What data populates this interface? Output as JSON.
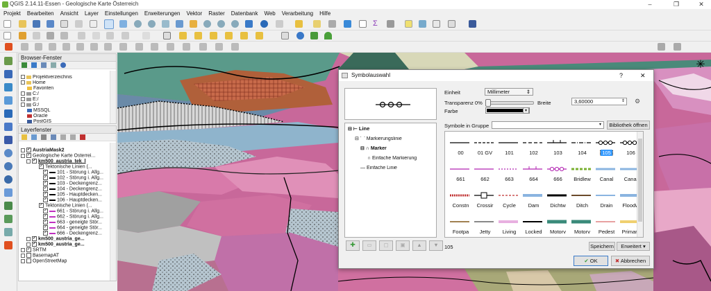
{
  "window": {
    "title": "QGIS 2.14.11-Essen - Geologische Karte Österreich"
  },
  "menu": [
    "Projekt",
    "Bearbeiten",
    "Ansicht",
    "Layer",
    "Einstellungen",
    "Erweiterungen",
    "Vektor",
    "Raster",
    "Datenbank",
    "Web",
    "Verarbeitung",
    "Hilfe"
  ],
  "browser": {
    "title": "Browser-Fenster",
    "items": [
      "Projektverzeichnis",
      "Home",
      "Favoriten",
      "C:/",
      "E:/",
      "G:/",
      "MSSQL",
      "Oracle",
      "PostGIS"
    ]
  },
  "layers": {
    "title": "Layerfenster",
    "items": [
      "AustriaMask2",
      "Geologische Karte Österrei...",
      "km500_austria_tek_l",
      "Tektonische Linien (...",
      "101 - Störung i. Allg...",
      "102 - Störung i. Allg...",
      "103 - Deckengrenz...",
      "104 - Deckengrenz...",
      "105 - Hauptdecken...",
      "106 - Hauptdecken...",
      "Tektonische Linien (...",
      "661 - Störung i. Allg...",
      "662 - Störung i. Allg...",
      "663 - geneigte Stör...",
      "664 - geneigte Stör...",
      "666 - Deckengrenz...",
      "km500_austria_ge...",
      "km500_austria_ge...",
      "SRTM",
      "BasemapAT",
      "OpenStreetMap"
    ]
  },
  "dialog": {
    "title": "Symbolauswahl",
    "help": "?",
    "close": "✕",
    "einheit_label": "Einheit",
    "einheit_value": "Millimeter",
    "transparenz_label": "Transparenz 0%",
    "breite_label": "Breite",
    "breite_value": "3,60000",
    "farbe_label": "Farbe",
    "color": "#000000",
    "tree": [
      "Line",
      "Markierungslinie",
      "Marker",
      "Einfache Markierung",
      "Einfache Linie"
    ],
    "group_label": "Symbole in Gruppe",
    "library_button": "Bibliothek öffnen",
    "symbols": [
      "00",
      "01 GV",
      "101",
      "102",
      "103",
      "104",
      "105",
      "106",
      "661",
      "662",
      "663",
      "664",
      "666",
      "Bridlew",
      "Canal",
      "Canal",
      "Constn",
      "Crossir",
      "Cycle",
      "Dam",
      "Dichtw",
      "Ditch",
      "Drain",
      "Floodw",
      "Footpa",
      "Jetty",
      "Living",
      "Locked",
      "Motorv",
      "Motorv",
      "Pedest",
      "Primary"
    ],
    "selected_symbol": "105",
    "save_button": "Speichern",
    "advanced_button": "Erweitert",
    "ok_button": "OK",
    "cancel_button": "Abbrechen"
  }
}
